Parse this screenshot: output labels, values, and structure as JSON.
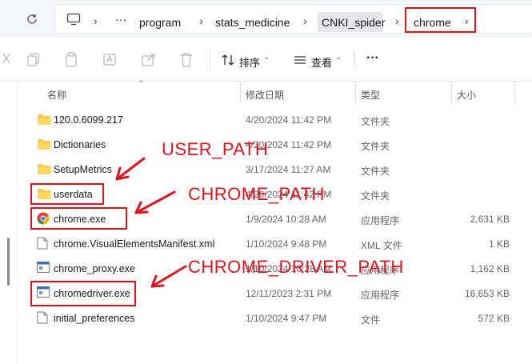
{
  "breadcrumb": {
    "more": "···",
    "items": [
      "program",
      "stats_medicine",
      "CNKI_spider",
      "chrome"
    ]
  },
  "toolbar": {
    "sort_label": "排序",
    "view_label": "查看",
    "more_label": "···"
  },
  "columns": {
    "name": "名称",
    "date": "修改日期",
    "type": "类型",
    "size": "大小"
  },
  "files": [
    {
      "name": "120.0.6099.217",
      "date": "4/20/2024 11:42 PM",
      "type": "文件夹",
      "size": "",
      "icon": "folder-icon"
    },
    {
      "name": "Dictionaries",
      "date": "4/20/2024 11:42 PM",
      "type": "文件夹",
      "size": "",
      "icon": "folder-icon"
    },
    {
      "name": "SetupMetrics",
      "date": "3/17/2024 11:27 AM",
      "type": "文件夹",
      "size": "",
      "icon": "folder-icon"
    },
    {
      "name": "userdata",
      "date": "4/20/2024 11:42 PM",
      "type": "文件夹",
      "size": "",
      "icon": "folder-icon"
    },
    {
      "name": "chrome.exe",
      "date": "1/9/2024 10:28 AM",
      "type": "应用程序",
      "size": "2,631 KB",
      "icon": "chrome-icon"
    },
    {
      "name": "chrome.VisualElementsManifest.xml",
      "date": "1/10/2024 9:48 PM",
      "type": "XML 文件",
      "size": "1 KB",
      "icon": "xml-file-icon"
    },
    {
      "name": "chrome_proxy.exe",
      "date": "1/10/2024 10:28 AM",
      "type": "应用程序",
      "size": "1,162 KB",
      "icon": "exe-icon"
    },
    {
      "name": "chromedriver.exe",
      "date": "12/11/2023 2:31 PM",
      "type": "应用程序",
      "size": "16,653 KB",
      "icon": "exe-icon"
    },
    {
      "name": "initial_preferences",
      "date": "1/10/2024 9:47 PM",
      "type": "文件",
      "size": "572 KB",
      "icon": "file-icon"
    }
  ],
  "annotations": {
    "user_path": "USER_PATH",
    "chrome_path": "CHROME_PATH",
    "chrome_driver_path": "CHROME_DRIVER_PATH"
  },
  "colors": {
    "annotation_red": "#e0141e",
    "folder_yellow": "#f7c948"
  }
}
